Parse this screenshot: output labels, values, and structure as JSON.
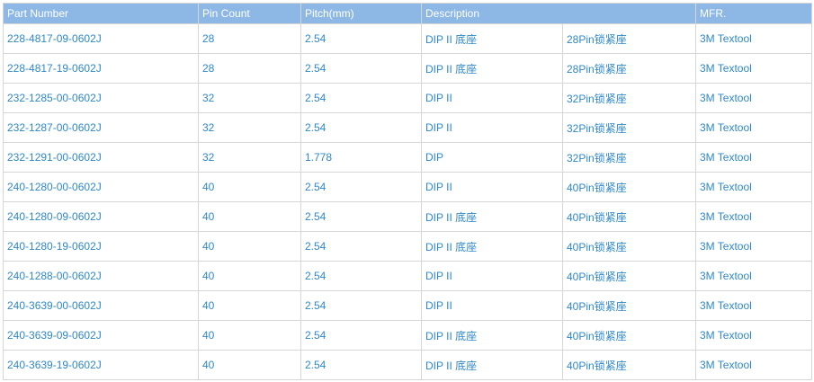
{
  "headers": [
    "Part Number",
    "Pin Count",
    "Pitch(mm)",
    "Description",
    "MFR."
  ],
  "rows": [
    [
      "228-4817-09-0602J",
      "28",
      "2.54",
      "DIP II 底座",
      "28Pin锁紧座",
      "3M Textool"
    ],
    [
      "228-4817-19-0602J",
      "28",
      "2.54",
      "DIP II 底座",
      "28Pin锁紧座",
      "3M Textool"
    ],
    [
      "232-1285-00-0602J",
      "32",
      "2.54",
      "DIP II",
      "32Pin锁紧座",
      "3M Textool"
    ],
    [
      "232-1287-00-0602J",
      "32",
      "2.54",
      "DIP II",
      "32Pin锁紧座",
      "3M Textool"
    ],
    [
      "232-1291-00-0602J",
      "32",
      "1.778",
      "DIP",
      "32Pin锁紧座",
      "3M Textool"
    ],
    [
      "240-1280-00-0602J",
      "40",
      "2.54",
      "DIP II",
      "40Pin锁紧座",
      "3M Textool"
    ],
    [
      "240-1280-09-0602J",
      "40",
      "2.54",
      "DIP II 底座",
      "40Pin锁紧座",
      "3M Textool"
    ],
    [
      "240-1280-19-0602J",
      "40",
      "2.54",
      "DIP II 底座",
      "40Pin锁紧座",
      "3M Textool"
    ],
    [
      "240-1288-00-0602J",
      "40",
      "2.54",
      "DIP II",
      "40Pin锁紧座",
      "3M Textool"
    ],
    [
      "240-3639-00-0602J",
      "40",
      "2.54",
      "DIP II",
      "40Pin锁紧座",
      "3M Textool"
    ],
    [
      "240-3639-09-0602J",
      "40",
      "2.54",
      "DIP II 底座",
      "40Pin锁紧座",
      "3M Textool"
    ],
    [
      "240-3639-19-0602J",
      "40",
      "2.54",
      "DIP II 底座",
      "40Pin锁紧座",
      "3M Textool"
    ]
  ],
  "colors": {
    "header_background": "#8db8e6",
    "header_text": "#ffffff",
    "cell_text": "#2f88c8",
    "grid": "#d6d6d6"
  }
}
